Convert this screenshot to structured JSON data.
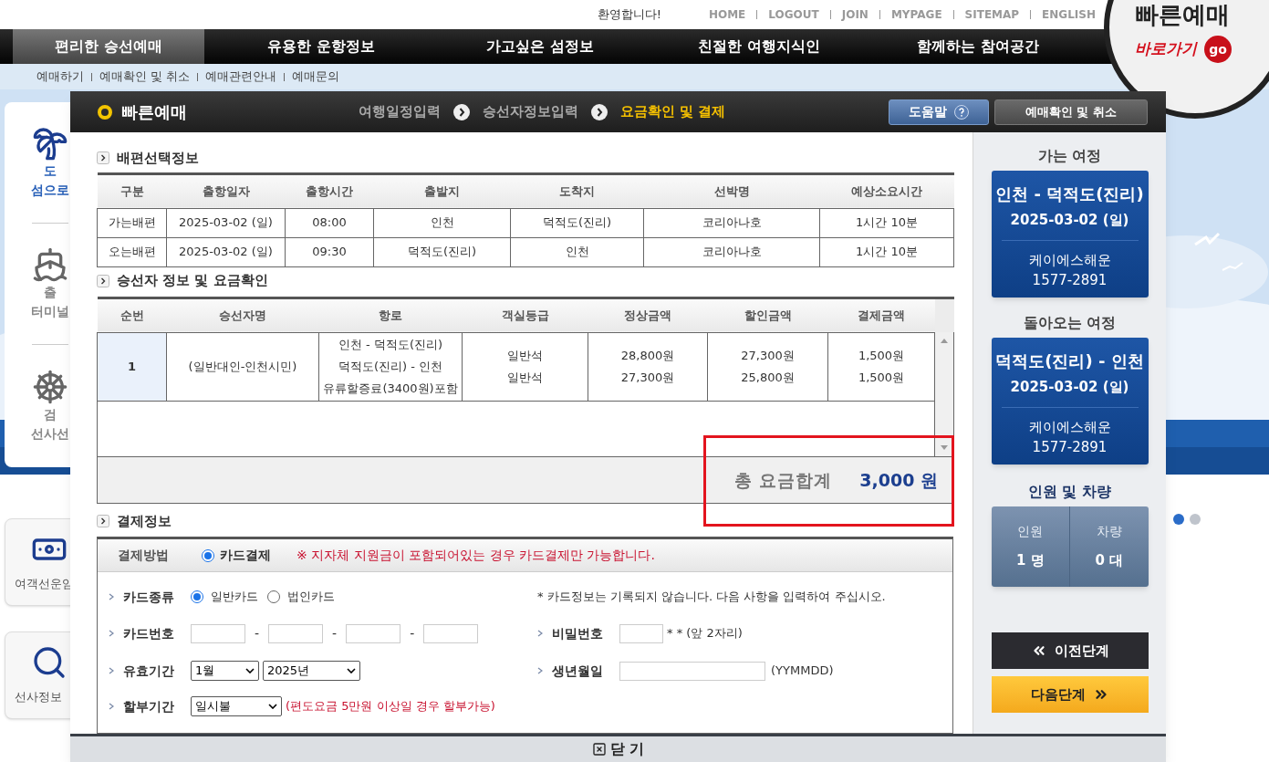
{
  "header": {
    "greeting": "환영합니다!",
    "links": [
      "HOME",
      "LOGOUT",
      "JOIN",
      "MYPAGE",
      "SITEMAP",
      "ENGLISH"
    ]
  },
  "nav": [
    {
      "label": "편리한 승선예매",
      "selected": true
    },
    {
      "label": "유용한 운항정보",
      "selected": false
    },
    {
      "label": "가고싶은 섬정보",
      "selected": false
    },
    {
      "label": "친절한 여행지식인",
      "selected": false
    },
    {
      "label": "함께하는 참여공간",
      "selected": false
    }
  ],
  "subnav": [
    "예매하기",
    "예매확인 및 취소",
    "예매관련안내",
    "예매문의"
  ],
  "side_menu": [
    {
      "lines": [
        "도",
        "섬으로"
      ]
    },
    {
      "lines": [
        "출",
        "터미널"
      ]
    },
    {
      "lines": [
        "검",
        "선사선"
      ]
    }
  ],
  "side_cards": [
    "여객선운임",
    "선사정보"
  ],
  "promo": {
    "title": "빠른예매",
    "link": "바로가기",
    "badge": "go"
  },
  "carousel_dots": [
    {
      "selected": true
    },
    {
      "selected": false
    }
  ],
  "modal": {
    "title": "빠른예매",
    "steps": [
      {
        "label": "여행일정입력",
        "selected": false
      },
      {
        "label": "승선자정보입력",
        "selected": false
      },
      {
        "label": "요금확인 및 결제",
        "selected": true
      }
    ],
    "buttons": [
      "도움말",
      "예매확인 및 취소"
    ],
    "voyage": {
      "title": "배편선택정보",
      "columns": [
        "구분",
        "출항일자",
        "출항시간",
        "출발지",
        "도착지",
        "선박명",
        "예상소요시간"
      ],
      "rows": [
        [
          "가는배편",
          "2025-03-02 (일)",
          "08:00",
          "인천",
          "덕적도(진리)",
          "코리아나호",
          "1시간 10분"
        ],
        [
          "오는배편",
          "2025-03-02 (일)",
          "09:30",
          "덕적도(진리)",
          "인천",
          "코리아나호",
          "1시간 10분"
        ]
      ]
    },
    "fares": {
      "title": "승선자 정보 및 요금확인",
      "columns": [
        "순번",
        "승선자명",
        "항로",
        "객실등급",
        "정상금액",
        "할인금액",
        "결제금액"
      ],
      "rows": [
        [
          [
            "1"
          ],
          [
            "(일반대인-인천시민)"
          ],
          [
            "인천 - 덕적도(진리)",
            "덕적도(진리) - 인천",
            "유류할증료(3400원)포함"
          ],
          [
            "일반석",
            "일반석"
          ],
          [
            "28,800원",
            "27,300원"
          ],
          [
            "27,300원",
            "25,800원"
          ],
          [
            "1,500원",
            "1,500원"
          ]
        ]
      ],
      "total_label": "총 요금합계",
      "total": "3,000 원"
    },
    "payment": {
      "title": "결제정보",
      "method_label": "결제방법",
      "method": {
        "label": "카드결제",
        "selected": true
      },
      "notice": "※ 지자체 지원금이 포함되어있는 경우 카드결제만 가능합니다.",
      "card_type": {
        "label": "카드종류",
        "options": [
          {
            "label": "일반카드",
            "selected": true
          },
          {
            "label": "법인카드",
            "selected": false
          }
        ]
      },
      "card_note": "*  카드정보는 기록되지 않습니다. 다음 사항을 입력하여 주십시오.",
      "card_number": {
        "label": "카드번호",
        "separators": [
          "-",
          "-",
          "-"
        ]
      },
      "password": {
        "label": "비밀번호",
        "hint": "* * (앞 2자리)"
      },
      "expiry": {
        "label": "유효기간",
        "month": "1월",
        "year": "2025년"
      },
      "birth": {
        "label": "생년월일",
        "hint": "(YYMMDD)"
      },
      "installment": {
        "label": "할부기간",
        "value": "일시불",
        "note": "(편도요금 5만원 이상일 경우 할부가능)"
      }
    },
    "sidebar": {
      "trips": [
        {
          "heading": "가는 여정",
          "route": "인천 - 덕적도(진리)",
          "date": "2025-03-02 (일)",
          "company": "케이에스해운",
          "phone": "1577-2891"
        },
        {
          "heading": "돌아오는 여정",
          "route": "덕적도(진리) - 인천",
          "date": "2025-03-02 (일)",
          "company": "케이에스해운",
          "phone": "1577-2891"
        }
      ],
      "people": {
        "heading": "인원 및 차량",
        "items": [
          {
            "label": "인원",
            "value": "1 명"
          },
          {
            "label": "차량",
            "value": "0 대"
          }
        ]
      },
      "prev": "이전단계",
      "next": "다음단계"
    },
    "close": "닫 기"
  }
}
